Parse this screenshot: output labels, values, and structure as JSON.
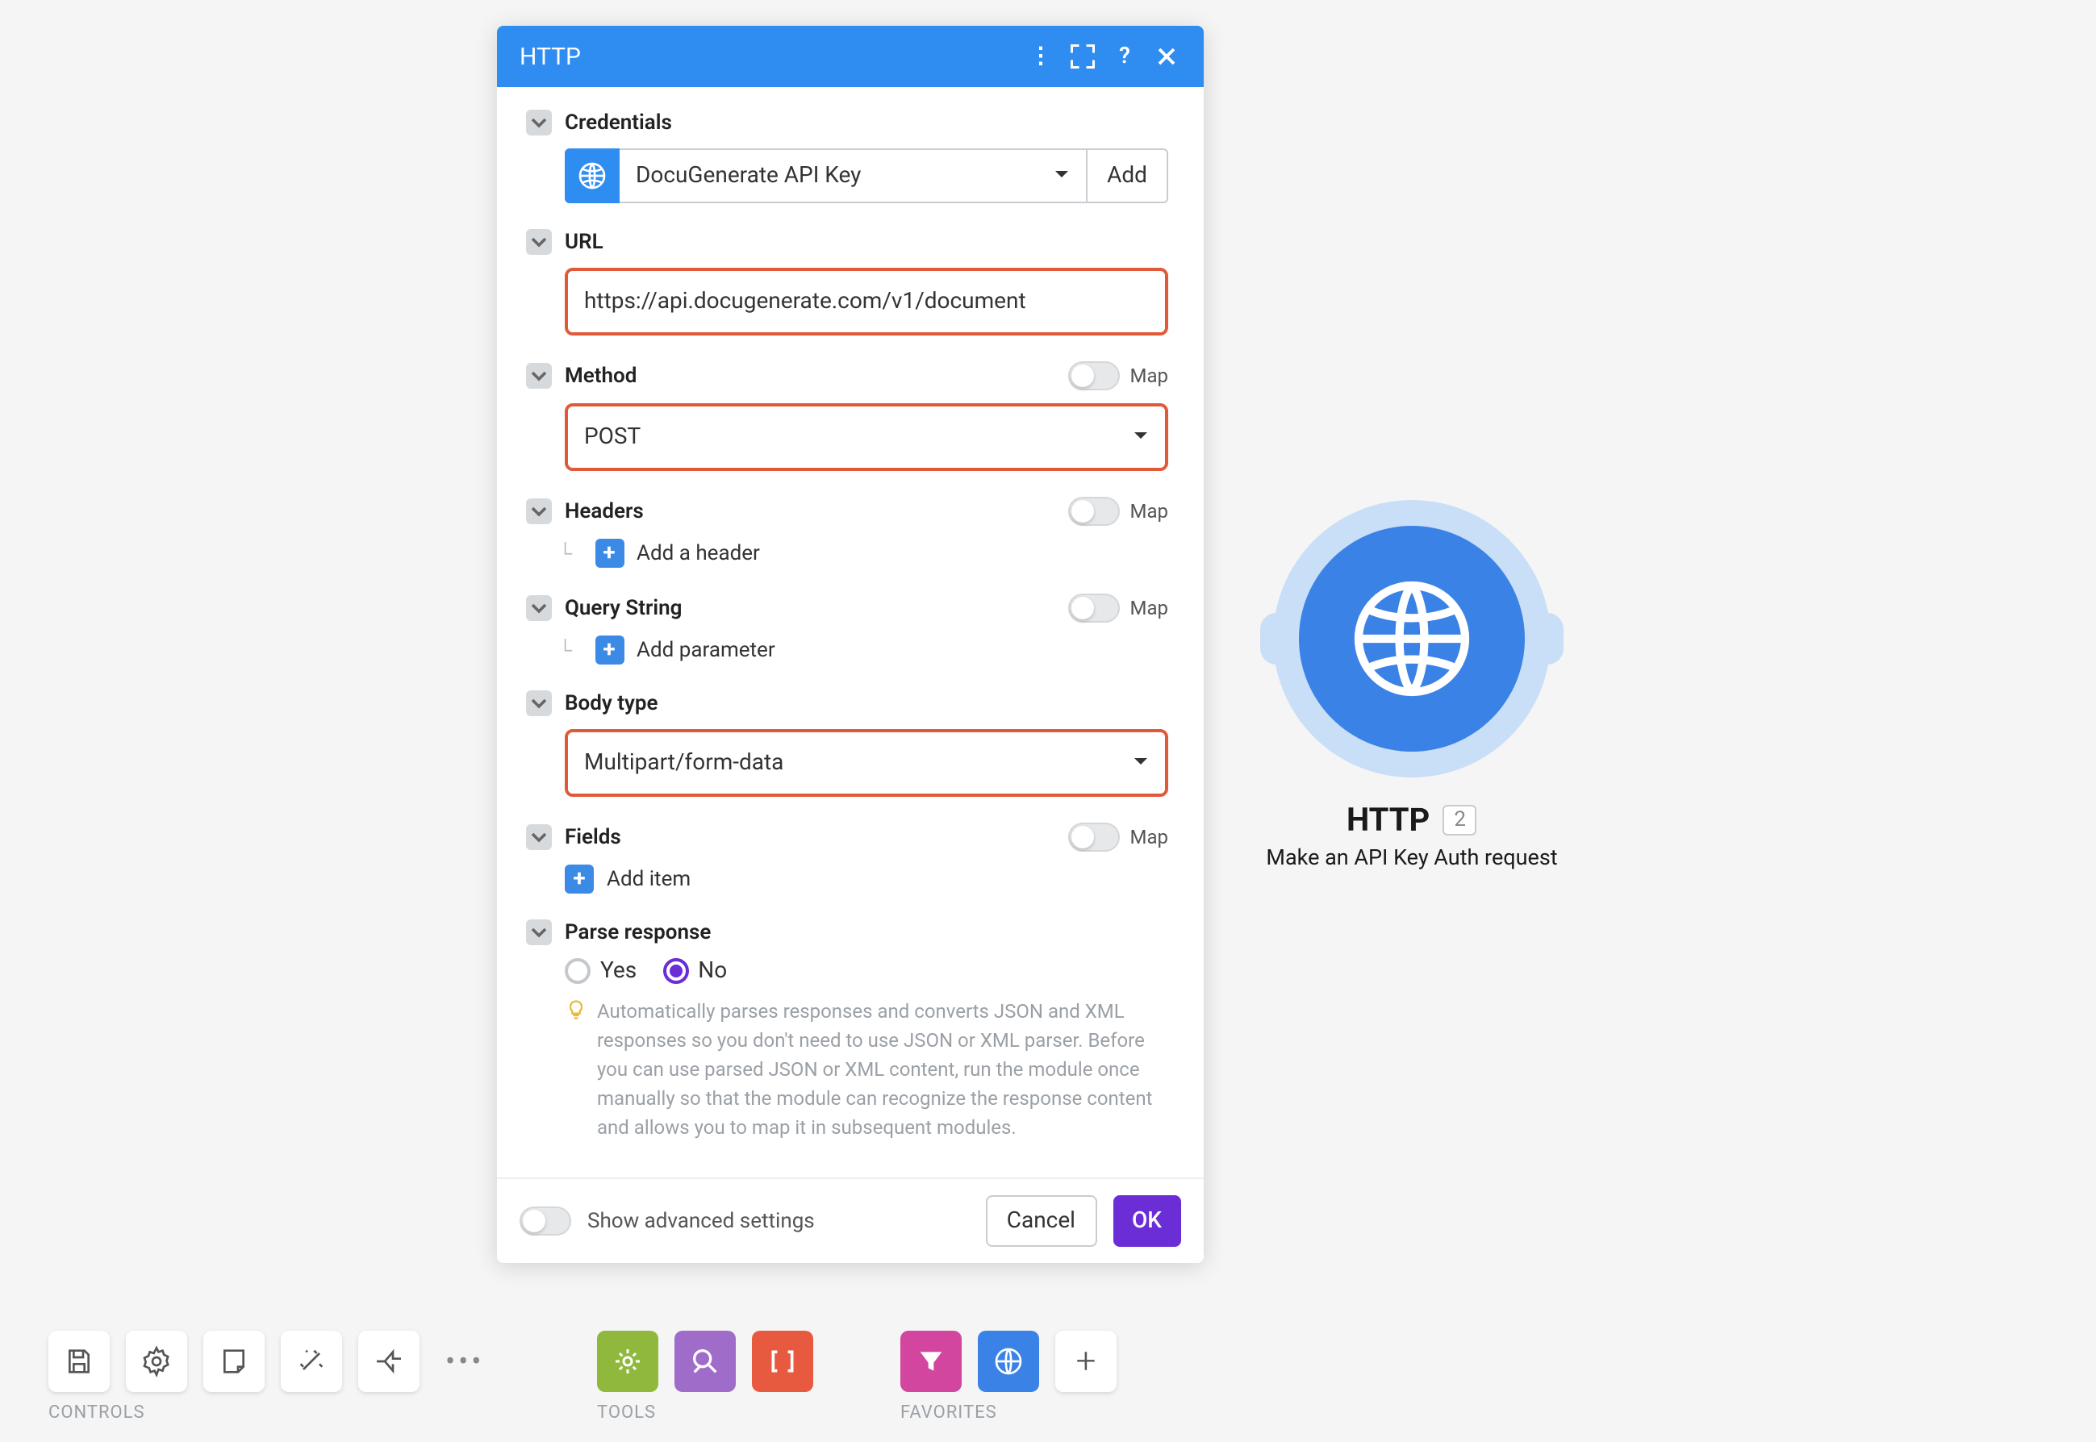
{
  "panel": {
    "title": "HTTP",
    "credentials": {
      "label": "Credentials",
      "value": "DocuGenerate API Key",
      "add_label": "Add"
    },
    "url": {
      "label": "URL",
      "value": "https://api.docugenerate.com/v1/document"
    },
    "method": {
      "label": "Method",
      "value": "POST",
      "map": "Map"
    },
    "headers": {
      "label": "Headers",
      "add": "Add a header",
      "map": "Map"
    },
    "query": {
      "label": "Query String",
      "add": "Add parameter",
      "map": "Map"
    },
    "bodytype": {
      "label": "Body type",
      "value": "Multipart/form-data"
    },
    "fields": {
      "label": "Fields",
      "add": "Add item",
      "map": "Map"
    },
    "parse": {
      "label": "Parse response",
      "yes": "Yes",
      "no": "No",
      "help": "Automatically parses responses and converts JSON and XML responses so you don't need to use JSON or XML parser. Before you can use parsed JSON or XML content, run the module once manually so that the module can recognize the response content and allows you to map it in subsequent modules."
    },
    "footer": {
      "advanced": "Show advanced settings",
      "cancel": "Cancel",
      "ok": "OK"
    }
  },
  "node": {
    "title": "HTTP",
    "number": "2",
    "subtitle": "Make an API Key Auth request"
  },
  "bottom": {
    "controls": "CONTROLS",
    "tools": "TOOLS",
    "favorites": "FAVORITES"
  }
}
